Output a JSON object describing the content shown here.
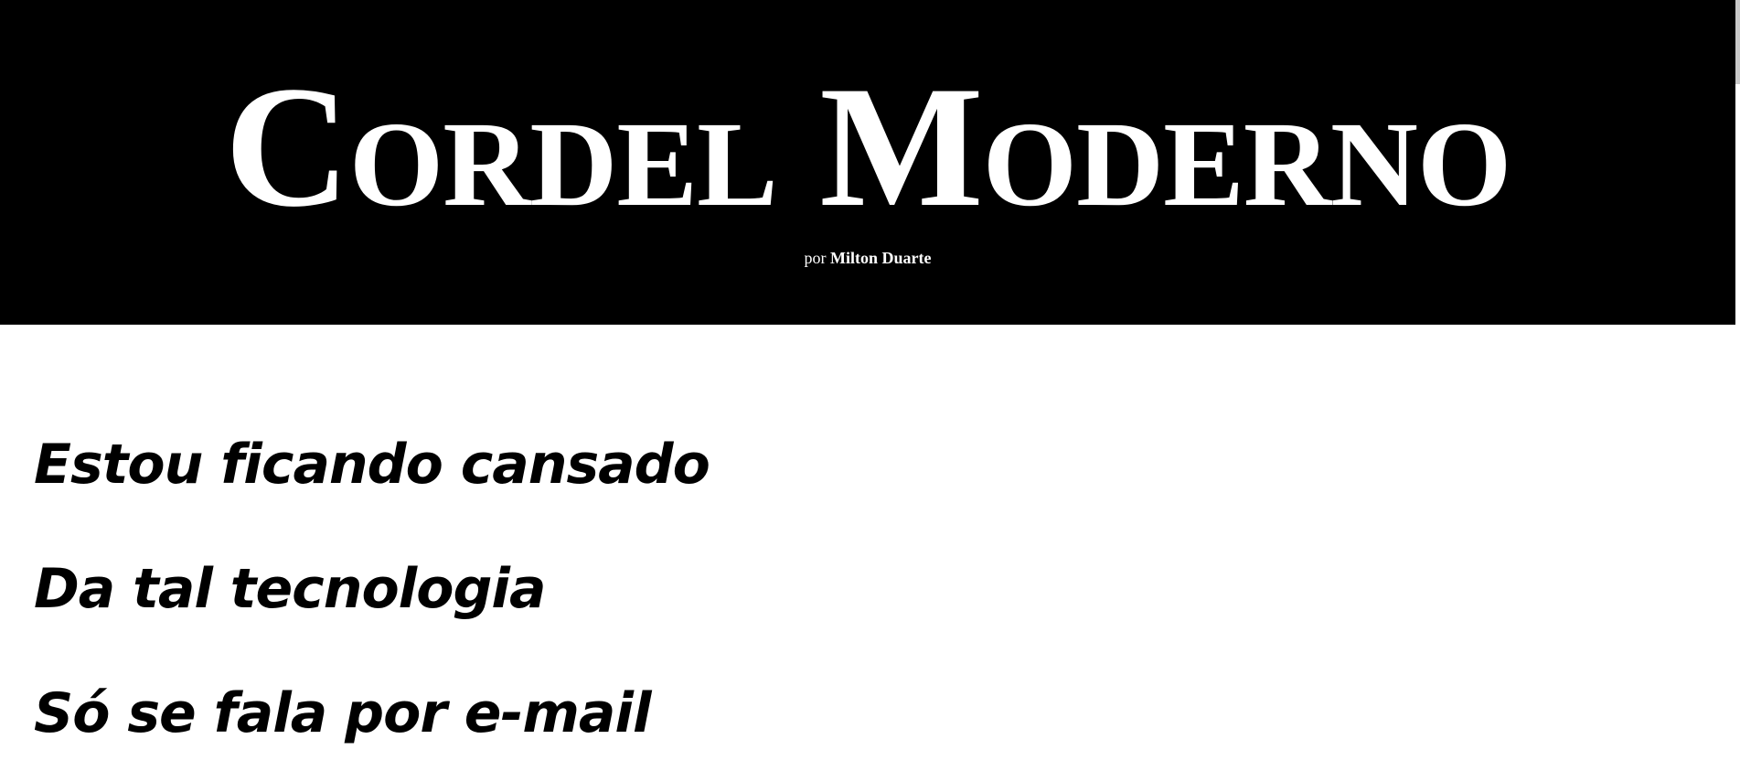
{
  "header": {
    "title": "Cordel Moderno",
    "byline_prefix": "por",
    "byline_author": "Milton Duarte"
  },
  "poem": {
    "verses": [
      "Estou ficando cansado",
      "Da tal tecnologia",
      "Só se fala por e-mail"
    ]
  },
  "colors": {
    "header_background": "#000000",
    "header_text": "#ffffff",
    "body_background": "#ffffff",
    "body_text": "#000000"
  }
}
